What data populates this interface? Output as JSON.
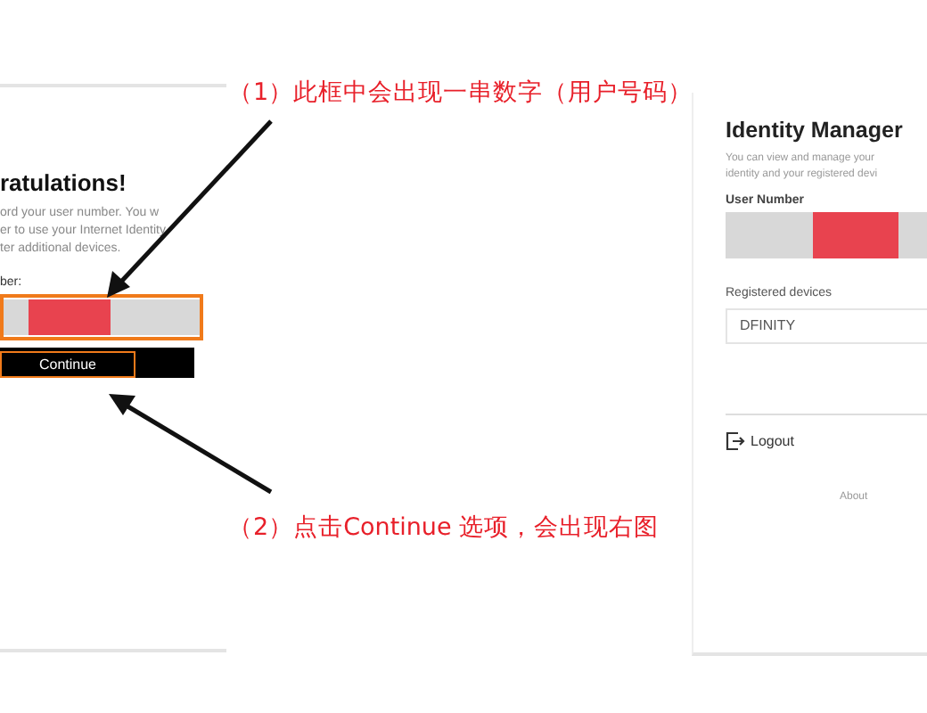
{
  "left_screen": {
    "heading": "ratulations!",
    "message_lines": [
      "ord your user number. You w",
      "er to use your Internet Identity",
      "ter additional devices."
    ],
    "field_label": "ber:",
    "continue_button": "Continue"
  },
  "right_screen": {
    "title": "Identity Manager",
    "description_lines": [
      "You can view and manage your",
      "identity and your registered devi"
    ],
    "user_number_label": "User Number",
    "devices_label": "Registered devices",
    "devices": [
      "DFINITY"
    ],
    "logout": "Logout",
    "about": "About"
  },
  "annotations": [
    {
      "kind": "top",
      "text": "（1）此框中会出现一串数字（用户号码）"
    },
    {
      "kind": "bottom",
      "text": "（2）点击Continue 选项，会出现右图"
    }
  ]
}
